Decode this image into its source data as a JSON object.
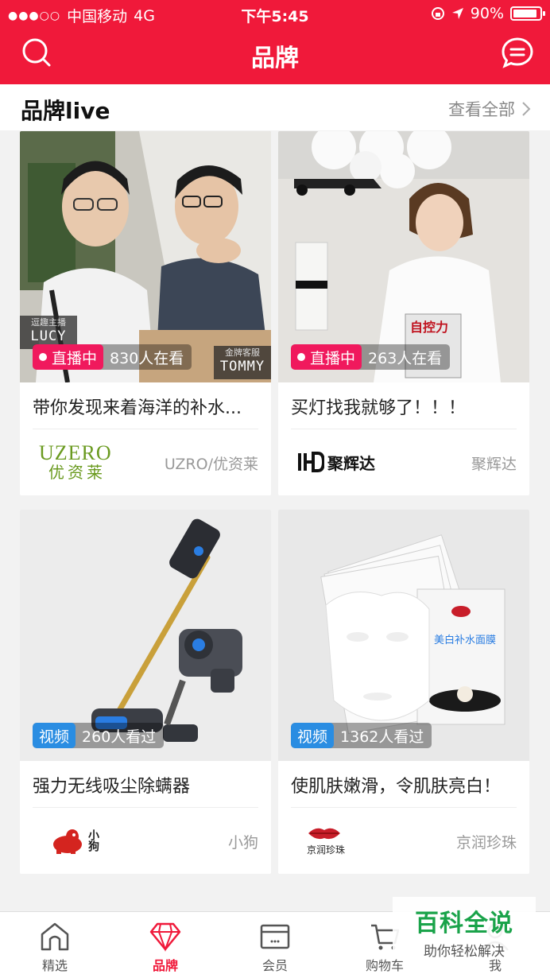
{
  "status_bar": {
    "carrier": "中国移动",
    "network": "4G",
    "time": "下午5:45",
    "battery": "90%"
  },
  "header": {
    "title": "品牌"
  },
  "section": {
    "title": "品牌live",
    "more_label": "查看全部"
  },
  "cards": [
    {
      "tag": "直播中",
      "count": "830人在看",
      "caption": "带你发现来着海洋的补水...",
      "brand_logo_text_1": "UZERO",
      "brand_logo_text_2": "优资莱",
      "brand_name": "UZRO/优资莱",
      "host_left_role": "逗趣主播",
      "host_left_name": "LUCY",
      "host_right_role": "金牌客服",
      "host_right_name": "TOMMY"
    },
    {
      "tag": "直播中",
      "count": "263人在看",
      "caption": "买灯找我就够了！！！",
      "brand_logo_text_1": "聚辉达",
      "brand_name": "聚辉达",
      "book_title": "自控力"
    },
    {
      "tag": "视频",
      "count": "260人看过",
      "caption": "强力无线吸尘除螨器",
      "brand_logo_text_1": "小狗",
      "brand_name": "小狗"
    },
    {
      "tag": "视频",
      "count": "1362人看过",
      "caption": "使肌肤嫩滑，令肌肤亮白！",
      "brand_logo_text_1": "京润珍珠",
      "brand_name": "京润珍珠",
      "box_text": "美白补水面膜"
    }
  ],
  "tabs": [
    {
      "label": "精选",
      "icon": "home-icon"
    },
    {
      "label": "品牌",
      "icon": "diamond-icon",
      "active": true
    },
    {
      "label": "会员",
      "icon": "card-icon"
    },
    {
      "label": "购物车",
      "icon": "cart-icon"
    },
    {
      "label": "我",
      "icon": "person-icon"
    }
  ],
  "watermark": {
    "line1": "百科全说",
    "line2": "助你轻松解决"
  },
  "colors": {
    "brand_red": "#f0193a",
    "live_pink": "#f0195d",
    "video_blue": "#2a8de2"
  }
}
